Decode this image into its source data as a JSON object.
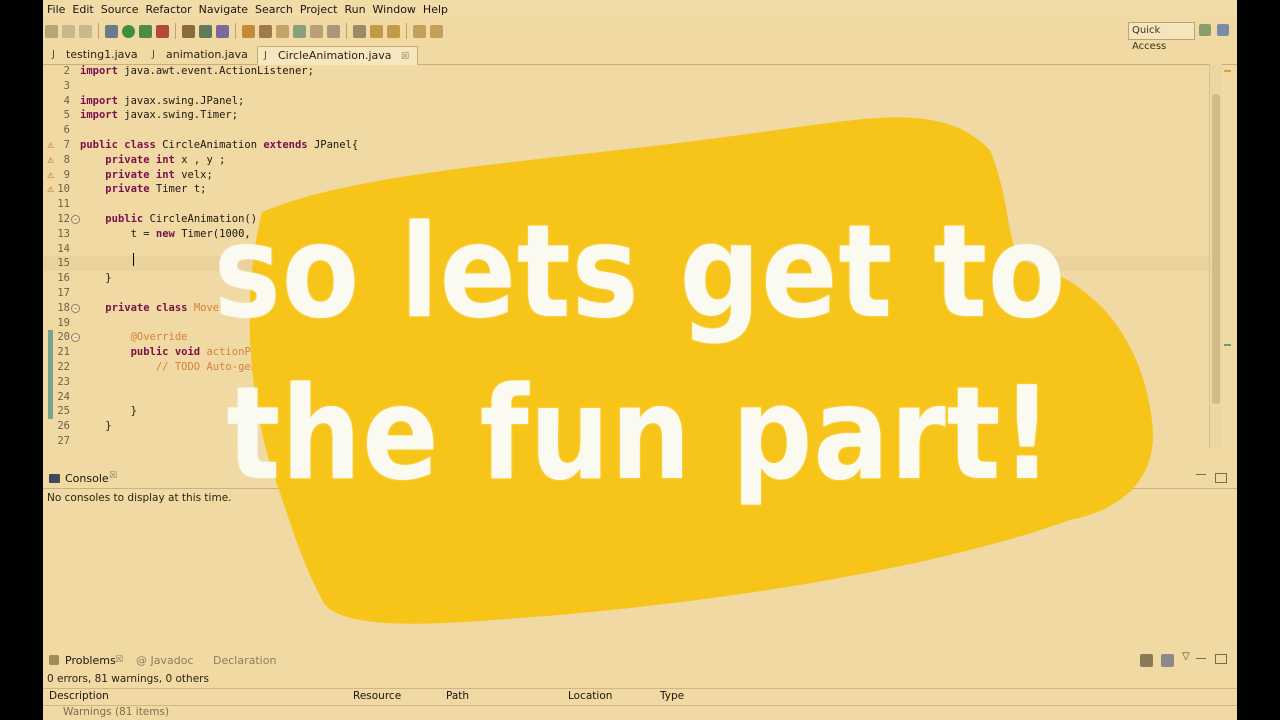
{
  "menu": [
    "File",
    "Edit",
    "Source",
    "Refactor",
    "Navigate",
    "Search",
    "Project",
    "Run",
    "Window",
    "Help"
  ],
  "quick_access": "Quick Access",
  "editor_tabs": [
    {
      "label": "testing1.java",
      "close": ""
    },
    {
      "label": "animation.java",
      "close": ""
    },
    {
      "label": "CircleAnimation.java",
      "close": "☒"
    }
  ],
  "code_lines": [
    {
      "n": "2",
      "text": "import java.awt.event.ActionListener;"
    },
    {
      "n": "3",
      "text": ""
    },
    {
      "n": "4",
      "text": "import javax.swing.JPanel;"
    },
    {
      "n": "5",
      "text": "import javax.swing.Timer;"
    },
    {
      "n": "6",
      "text": ""
    },
    {
      "n": "7",
      "text": "public class CircleAnimation extends JPanel{"
    },
    {
      "n": "8",
      "text": "    private int x , y ;"
    },
    {
      "n": "9",
      "text": "    private int velx;"
    },
    {
      "n": "10",
      "text": "    private Timer t;"
    },
    {
      "n": "11",
      "text": ""
    },
    {
      "n": "12",
      "text": "    public CircleAnimation() {"
    },
    {
      "n": "13",
      "text": "        t = new Timer(1000, new MoveListener());"
    },
    {
      "n": "14",
      "text": ""
    },
    {
      "n": "15",
      "text": ""
    },
    {
      "n": "16",
      "text": "    }"
    },
    {
      "n": "17",
      "text": ""
    },
    {
      "n": "18",
      "text": "    private class MoveListener"
    },
    {
      "n": "19",
      "text": ""
    },
    {
      "n": "20",
      "text": "        @Override"
    },
    {
      "n": "21",
      "text": "        public void actionPerformed(ActionEvent e) {"
    },
    {
      "n": "22",
      "text": "            // TODO Auto-generated method stub"
    },
    {
      "n": "23",
      "text": ""
    },
    {
      "n": "24",
      "text": ""
    },
    {
      "n": "25",
      "text": "        }"
    },
    {
      "n": "26",
      "text": "    }"
    },
    {
      "n": "27",
      "text": ""
    }
  ],
  "console": {
    "title": "Console",
    "close": "☒",
    "message": "No consoles to display at this time."
  },
  "problems": {
    "tabs": [
      "Problems",
      "@ Javadoc",
      "Declaration"
    ],
    "close": "☒",
    "summary": "0 errors, 81 warnings, 0 others",
    "columns": [
      "Description",
      "Resource",
      "Path",
      "Location",
      "Type"
    ],
    "first_row": "Warnings (81 items)"
  },
  "overlay": {
    "line1": "so lets get to",
    "line2": "the fun part!",
    "brush_color": "#f7c519",
    "text_color": "#fbfaf0"
  }
}
